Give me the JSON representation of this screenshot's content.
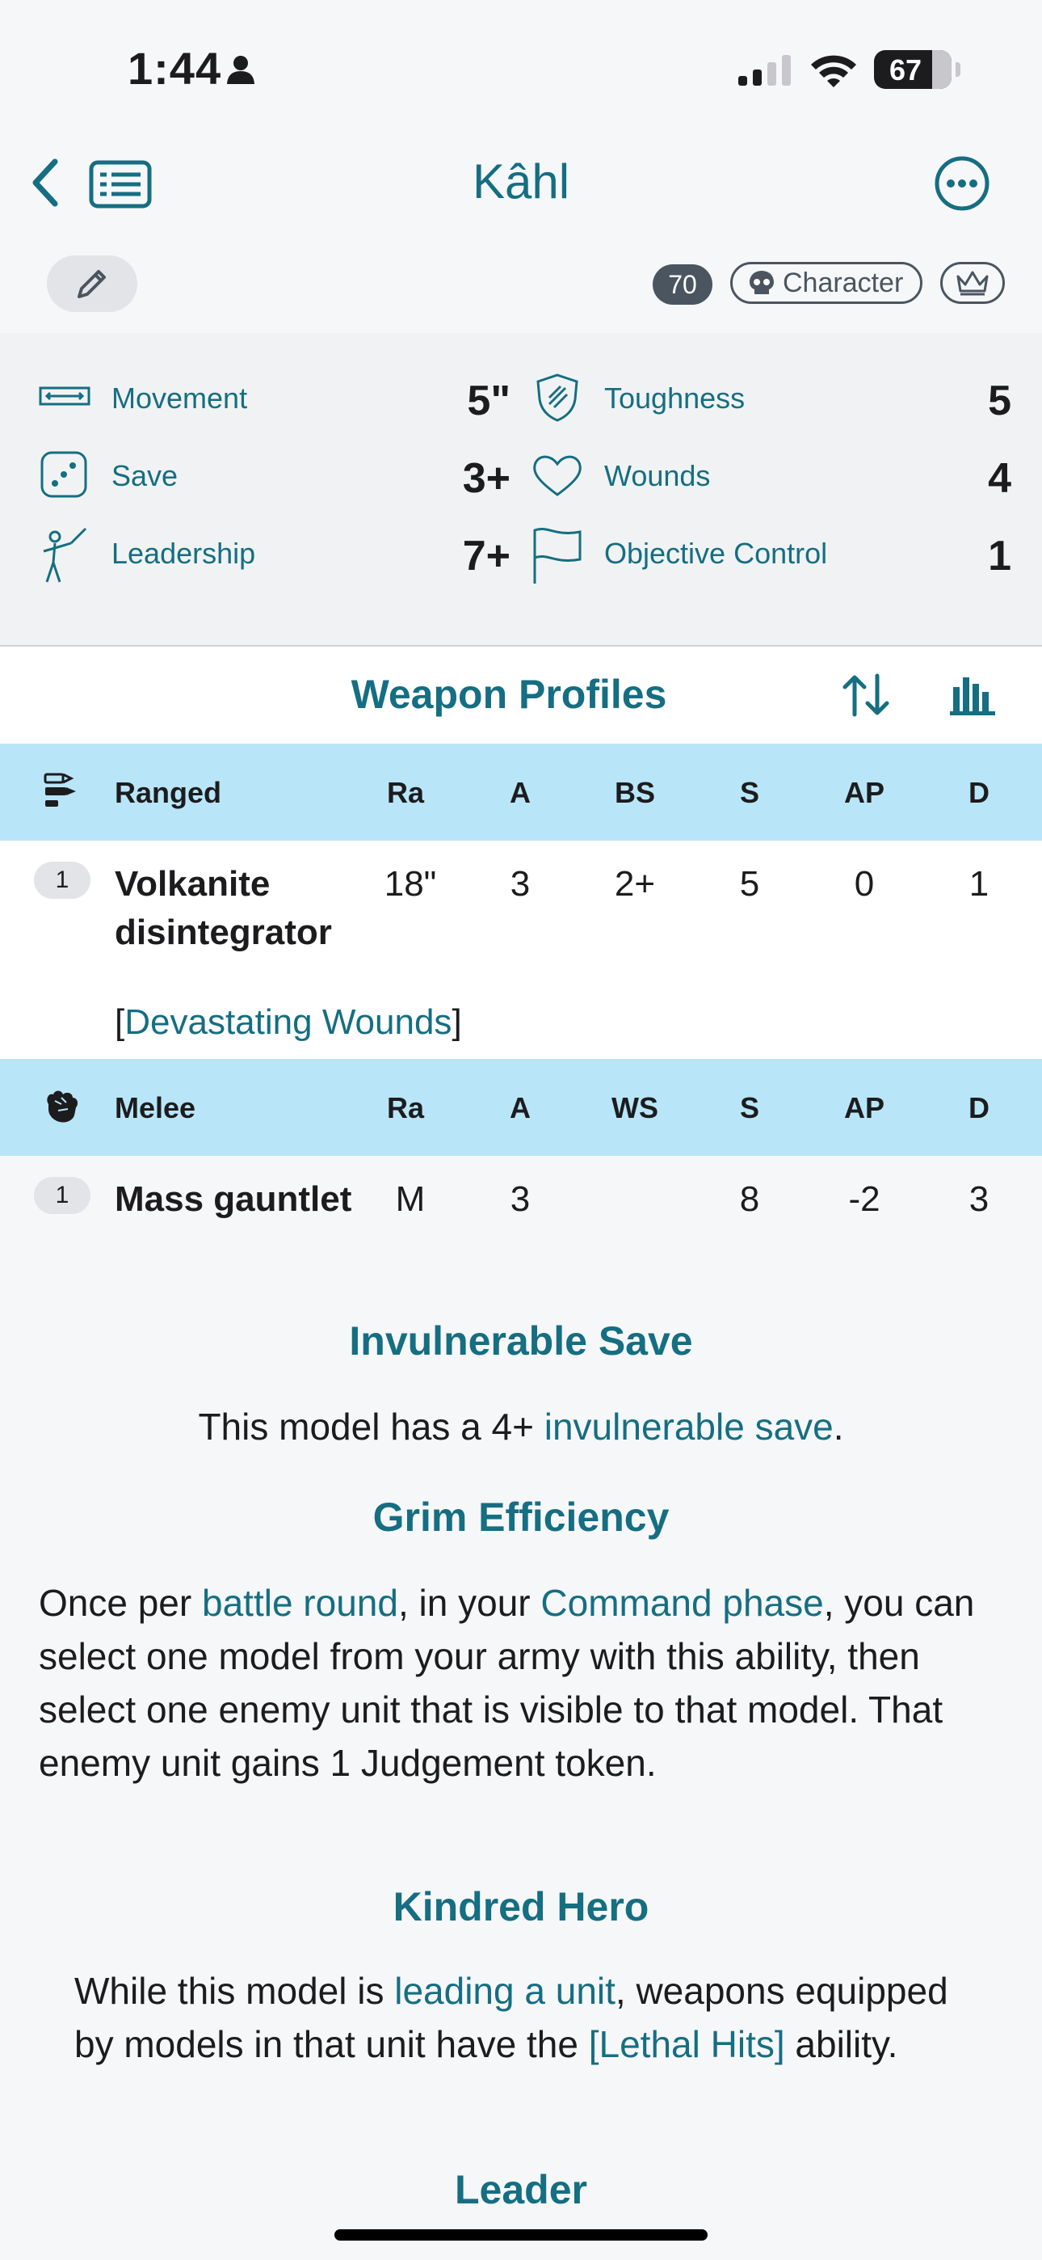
{
  "status_bar": {
    "time": "1:44",
    "battery": "67"
  },
  "nav": {
    "title": "Kâhl"
  },
  "badges": {
    "points": "70",
    "character": "Character"
  },
  "stats": {
    "movement": {
      "label": "Movement",
      "value": "5\""
    },
    "save": {
      "label": "Save",
      "value": "3+"
    },
    "leadership": {
      "label": "Leadership",
      "value": "7+"
    },
    "toughness": {
      "label": "Toughness",
      "value": "5"
    },
    "wounds": {
      "label": "Wounds",
      "value": "4"
    },
    "objective_control": {
      "label": "Objective Control",
      "value": "1"
    }
  },
  "weapons": {
    "title": "Weapon Profiles",
    "ranged": {
      "label": "Ranged",
      "columns": [
        "Ra",
        "A",
        "BS",
        "S",
        "AP",
        "D"
      ],
      "rows": [
        {
          "count": "1",
          "name": "Volkanite disintegrator",
          "values": [
            "18\"",
            "3",
            "2+",
            "5",
            "0",
            "1"
          ],
          "kw_open": "[",
          "keyword": "Devastating Wounds",
          "kw_close": "]"
        }
      ]
    },
    "melee": {
      "label": "Melee",
      "columns": [
        "Ra",
        "A",
        "WS",
        "S",
        "AP",
        "D"
      ],
      "rows": [
        {
          "count": "1",
          "name": "Mass gauntlet",
          "values": [
            "M",
            "3",
            "",
            "8",
            "-2",
            "3"
          ]
        }
      ]
    }
  },
  "abilities": {
    "invuln": {
      "title": "Invulnerable Save",
      "pre": "This model has a 4+ ",
      "link": "invulnerable save",
      "post": "."
    },
    "grim": {
      "title": "Grim Efficiency",
      "t1": "Once per ",
      "l1": "battle round",
      "t2": ", in your ",
      "l2": "Command phase",
      "t3": ", you can select one model from your army with this ability, then select one enemy unit that is visible to that model. That enemy unit gains 1 Judgement token."
    },
    "kindred": {
      "title": "Kindred Hero",
      "t1": "While this model is ",
      "l1": "leading a unit",
      "t2": ", weapons equipped by models in that unit have the ",
      "l2": "[Lethal Hits]",
      "t3": " ability."
    },
    "leader": {
      "title": "Leader"
    }
  }
}
